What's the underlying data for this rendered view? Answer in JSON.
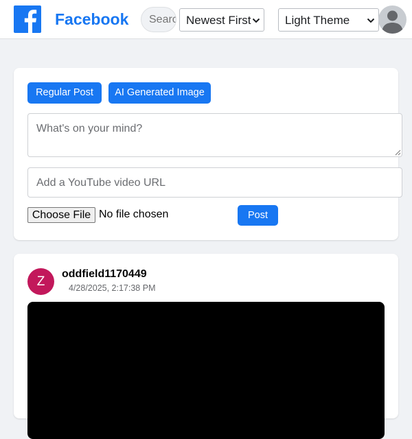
{
  "header": {
    "brand": "Facebook",
    "search_placeholder": "Search",
    "sort_selected": "Newest First",
    "theme_selected": "Light Theme"
  },
  "composer": {
    "regular_post_label": "Regular Post",
    "ai_image_label": "AI Generated Image",
    "text_placeholder": "What's on your mind?",
    "url_placeholder": "Add a YouTube video URL",
    "choose_file_label": "Choose File",
    "file_status": "No file chosen",
    "post_label": "Post"
  },
  "posts": [
    {
      "avatar_letter": "Z",
      "username": "oddfield1170449",
      "timestamp": "4/28/2025, 2:17:38 PM"
    }
  ],
  "colors": {
    "brand": "#1877f2",
    "background": "#f0f2f5",
    "avatar": "#c2185b"
  },
  "icons": [
    "facebook-logo-icon",
    "chevron-down-icon",
    "user-avatar-icon",
    "resize-grip-icon"
  ]
}
